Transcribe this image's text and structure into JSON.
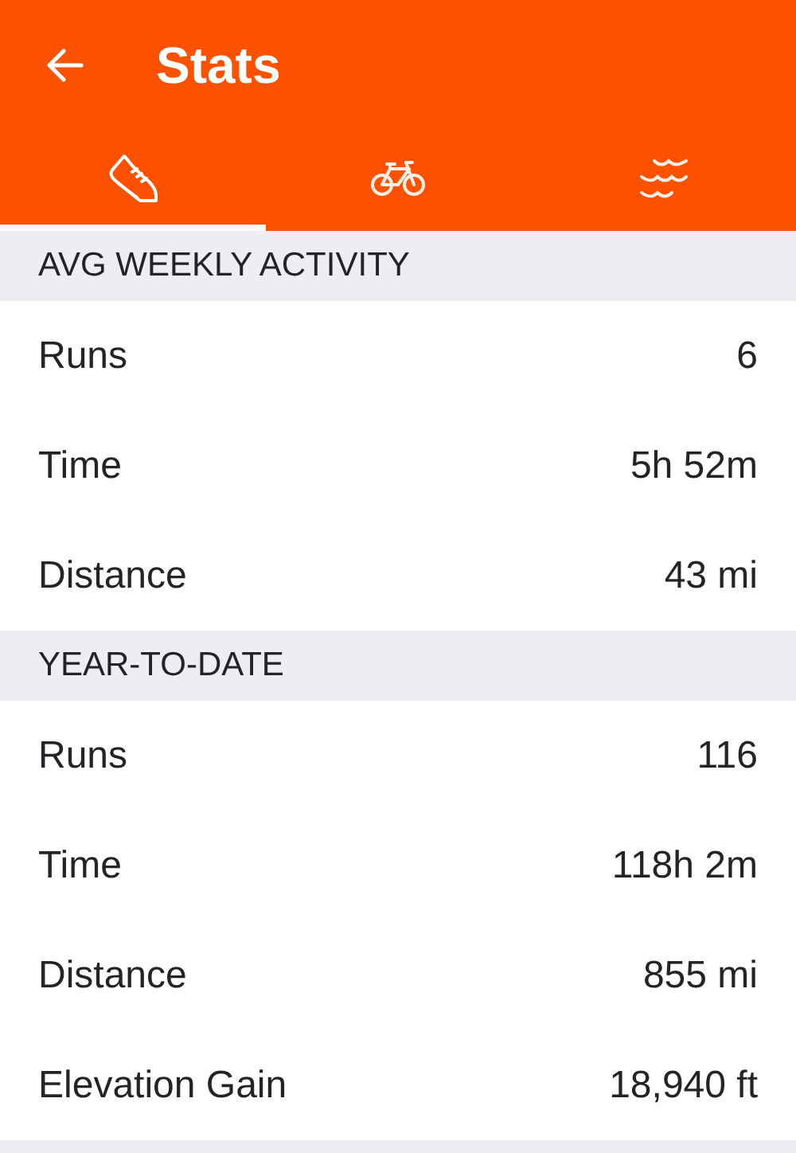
{
  "header": {
    "title": "Stats"
  },
  "tabs": [
    {
      "kind": "run",
      "selected": true
    },
    {
      "kind": "ride",
      "selected": false
    },
    {
      "kind": "swim",
      "selected": false
    }
  ],
  "sections": [
    {
      "title": "AVG WEEKLY ACTIVITY",
      "rows": [
        {
          "label": "Runs",
          "value": "6"
        },
        {
          "label": "Time",
          "value": "5h 52m"
        },
        {
          "label": "Distance",
          "value": "43 mi"
        }
      ]
    },
    {
      "title": "YEAR-TO-DATE",
      "rows": [
        {
          "label": "Runs",
          "value": "116"
        },
        {
          "label": "Time",
          "value": "118h 2m"
        },
        {
          "label": "Distance",
          "value": "855 mi"
        },
        {
          "label": "Elevation Gain",
          "value": "18,940 ft"
        }
      ]
    }
  ]
}
